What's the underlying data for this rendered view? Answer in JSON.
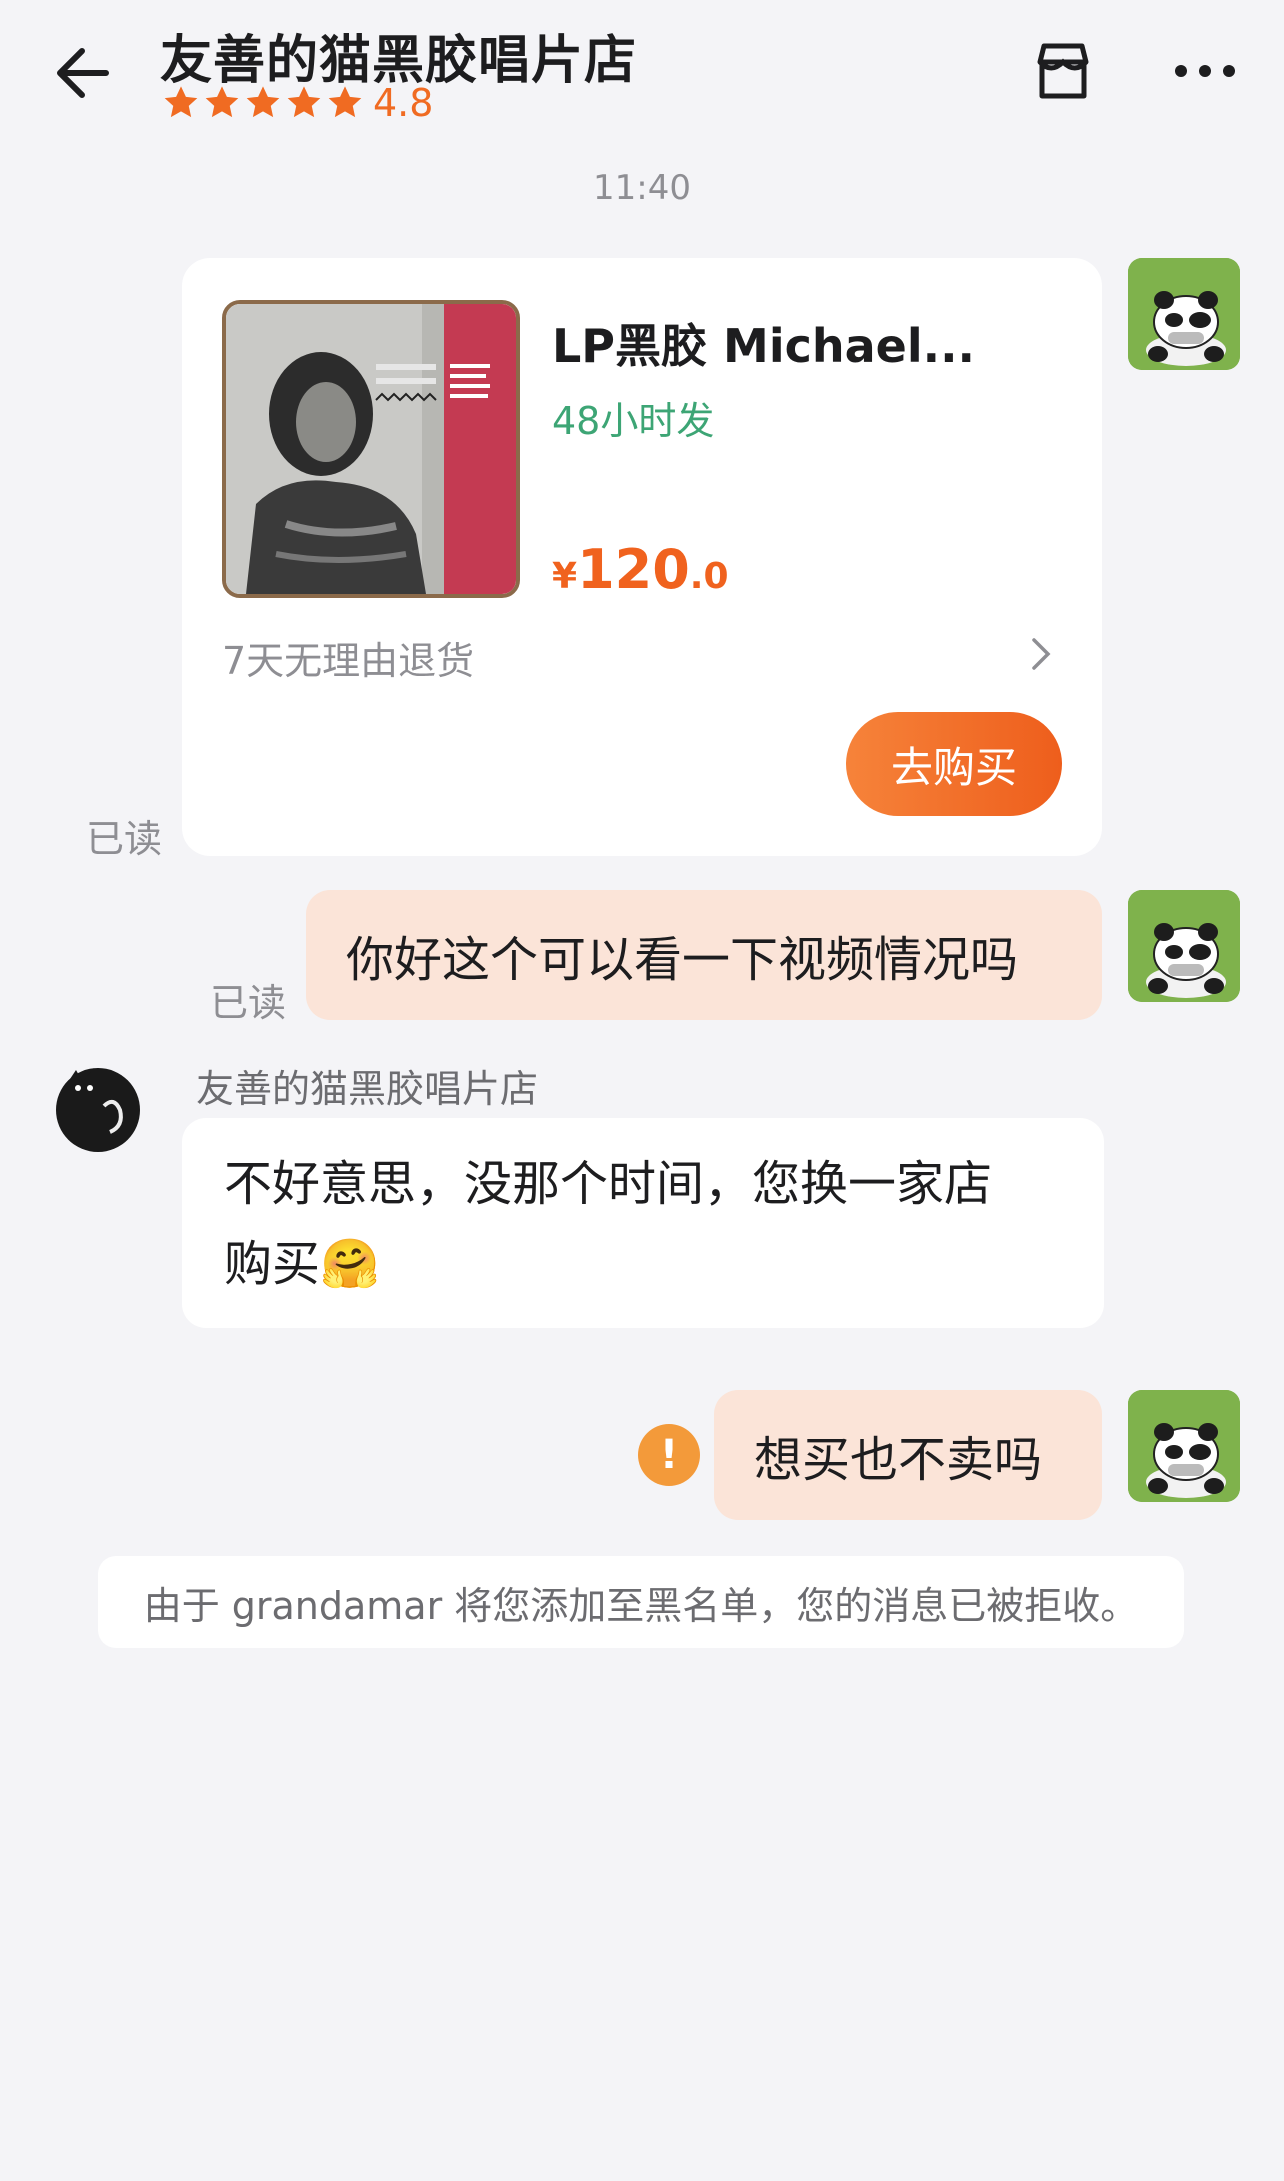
{
  "header": {
    "title": "友善的猫黑胶唱片店",
    "rating": "4.8",
    "star_count": 5,
    "icons": [
      "back-arrow-icon",
      "store-icon",
      "more-icon"
    ]
  },
  "timestamp": "11:40",
  "product_card": {
    "title": "LP黑胶 Michael...",
    "shipping": "48小时发",
    "price_currency": "¥",
    "price_integer": "120",
    "price_decimal": ".0",
    "returns_text": "7天无理由退货",
    "buy_label": "去购买",
    "read_status": "已读"
  },
  "messages": [
    {
      "from": "me",
      "text": "你好这个可以看一下视频情况吗",
      "read_status": "已读"
    },
    {
      "from": "shop",
      "sender": "友善的猫黑胶唱片店",
      "line1": "不好意思，没那个时间，您换一家店",
      "line2": "购买",
      "emoji": "🤗"
    },
    {
      "from": "me",
      "text": "想买也不卖吗",
      "failed_icon": "!"
    }
  ],
  "system_notice": "由于 grandamar 将您添加至黑名单，您的消息已被拒收。",
  "colors": {
    "accent": "#f06b22",
    "shipping_green": "#3da575",
    "my_bubble": "#fbe4d8",
    "error": "#f39a3a"
  }
}
